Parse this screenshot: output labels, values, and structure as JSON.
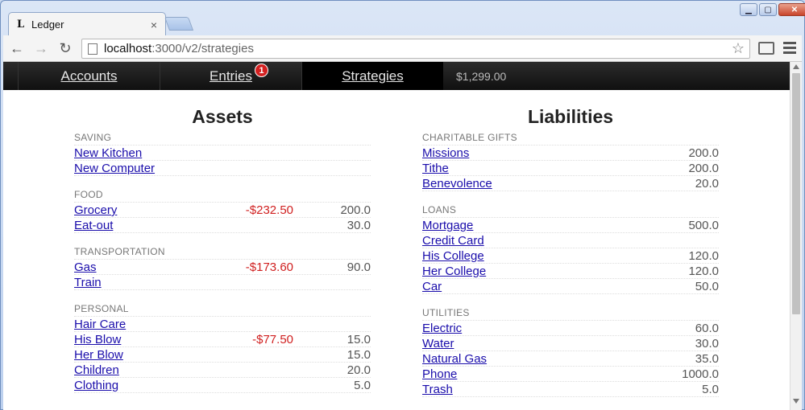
{
  "browser": {
    "tab_favicon": "L",
    "tab_title": "Ledger",
    "tab_close": "×",
    "url_host": "localhost",
    "url_path": ":3000/v2/strategies",
    "back_icon": "←",
    "forward_icon": "→",
    "reload_icon": "↻",
    "star_icon": "☆"
  },
  "nav": {
    "tabs": [
      {
        "label": "Accounts"
      },
      {
        "label": "Entries",
        "badge": "1"
      },
      {
        "label": "Strategies"
      }
    ],
    "balance": "$1,299.00"
  },
  "assets": {
    "title": "Assets",
    "groups": [
      {
        "name": "SAVING",
        "items": [
          {
            "label": "New Kitchen",
            "spent": "",
            "amount": ""
          },
          {
            "label": "New Computer",
            "spent": "",
            "amount": ""
          }
        ]
      },
      {
        "name": "FOOD",
        "items": [
          {
            "label": "Grocery",
            "spent": "-$232.50",
            "amount": "200.0"
          },
          {
            "label": "Eat-out",
            "spent": "",
            "amount": "30.0"
          }
        ]
      },
      {
        "name": "TRANSPORTATION",
        "items": [
          {
            "label": "Gas",
            "spent": "-$173.60",
            "amount": "90.0"
          },
          {
            "label": "Train",
            "spent": "",
            "amount": ""
          }
        ]
      },
      {
        "name": "PERSONAL",
        "items": [
          {
            "label": "Hair Care",
            "spent": "",
            "amount": ""
          },
          {
            "label": "His Blow",
            "spent": "-$77.50",
            "amount": "15.0"
          },
          {
            "label": "Her Blow",
            "spent": "",
            "amount": "15.0"
          },
          {
            "label": "Children",
            "spent": "",
            "amount": "20.0"
          },
          {
            "label": "Clothing",
            "spent": "",
            "amount": "5.0"
          }
        ]
      }
    ]
  },
  "liabilities": {
    "title": "Liabilities",
    "groups": [
      {
        "name": "CHARITABLE GIFTS",
        "items": [
          {
            "label": "Missions",
            "amount": "200.0"
          },
          {
            "label": "Tithe",
            "amount": "200.0"
          },
          {
            "label": "Benevolence",
            "amount": "20.0"
          }
        ]
      },
      {
        "name": "LOANS",
        "items": [
          {
            "label": "Mortgage",
            "amount": "500.0"
          },
          {
            "label": "Credit Card",
            "amount": ""
          },
          {
            "label": "His College",
            "amount": "120.0"
          },
          {
            "label": "Her College",
            "amount": "120.0"
          },
          {
            "label": "Car",
            "amount": "50.0"
          }
        ]
      },
      {
        "name": "UTILITIES",
        "items": [
          {
            "label": "Electric",
            "amount": "60.0"
          },
          {
            "label": "Water",
            "amount": "30.0"
          },
          {
            "label": "Natural Gas",
            "amount": "35.0"
          },
          {
            "label": "Phone",
            "amount": "1000.0"
          },
          {
            "label": "Trash",
            "amount": "5.0"
          }
        ]
      }
    ]
  }
}
